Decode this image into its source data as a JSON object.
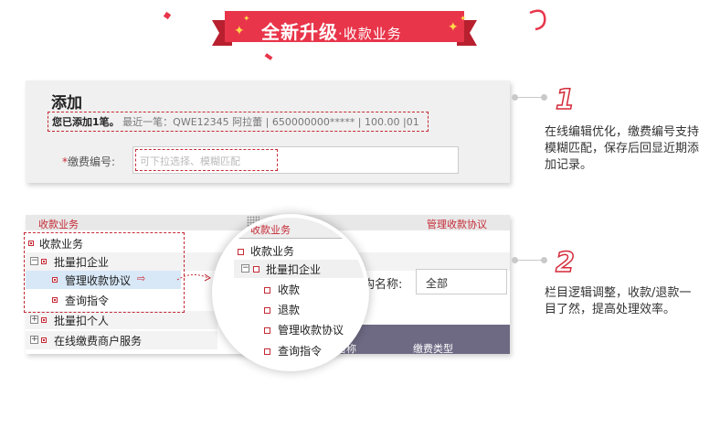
{
  "banner": {
    "title": "全新升级",
    "subtitle": "·收款业务",
    "color": "#e8354a"
  },
  "panel1": {
    "title": "添加",
    "recent_count": "您已添加1笔。",
    "recent_detail": "最近一笔：QWE12345 阿拉蕾 | 650000000***** | 100.00 |01",
    "fee_required": "*",
    "fee_label": "缴费编号:",
    "fee_placeholder": "可下拉选择、模糊匹配"
  },
  "notes": [
    {
      "number": "1",
      "text": "在线编辑优化，缴费编号支持模糊匹配，保存后回显近期添加记录。"
    },
    {
      "number": "2",
      "text": "栏目逻辑调整，收款/退款一目了然，提高处理效率。"
    }
  ],
  "panel2": {
    "header_left": "收款业务",
    "header_right": "管理收款协议",
    "tree": [
      {
        "label": "收款业务",
        "level": 0,
        "toggle": "",
        "selected": false
      },
      {
        "label": "批量扣企业",
        "level": 1,
        "toggle": "−",
        "selected": false
      },
      {
        "label": "管理收款协议",
        "level": 2,
        "toggle": "",
        "selected": true
      },
      {
        "label": "查询指令",
        "level": 2,
        "toggle": "",
        "selected": false
      },
      {
        "label": "批量扣个人",
        "level": 1,
        "toggle": "+",
        "selected": false
      },
      {
        "label": "在线缴费商户服务",
        "level": 1,
        "toggle": "+",
        "selected": false
      }
    ],
    "arrow": "⇨",
    "org_label": "机构名称:",
    "org_value": "全部",
    "table_headers": [
      "名称",
      "缴费类型"
    ]
  },
  "magnifier": {
    "header": "收款业务",
    "items": [
      {
        "label": "收款业务"
      },
      {
        "label": "批量扣企业",
        "toggle": "−"
      },
      {
        "label": "收款"
      },
      {
        "label": "退款"
      },
      {
        "label": "管理收款协议"
      },
      {
        "label": "查询指令"
      }
    ]
  }
}
